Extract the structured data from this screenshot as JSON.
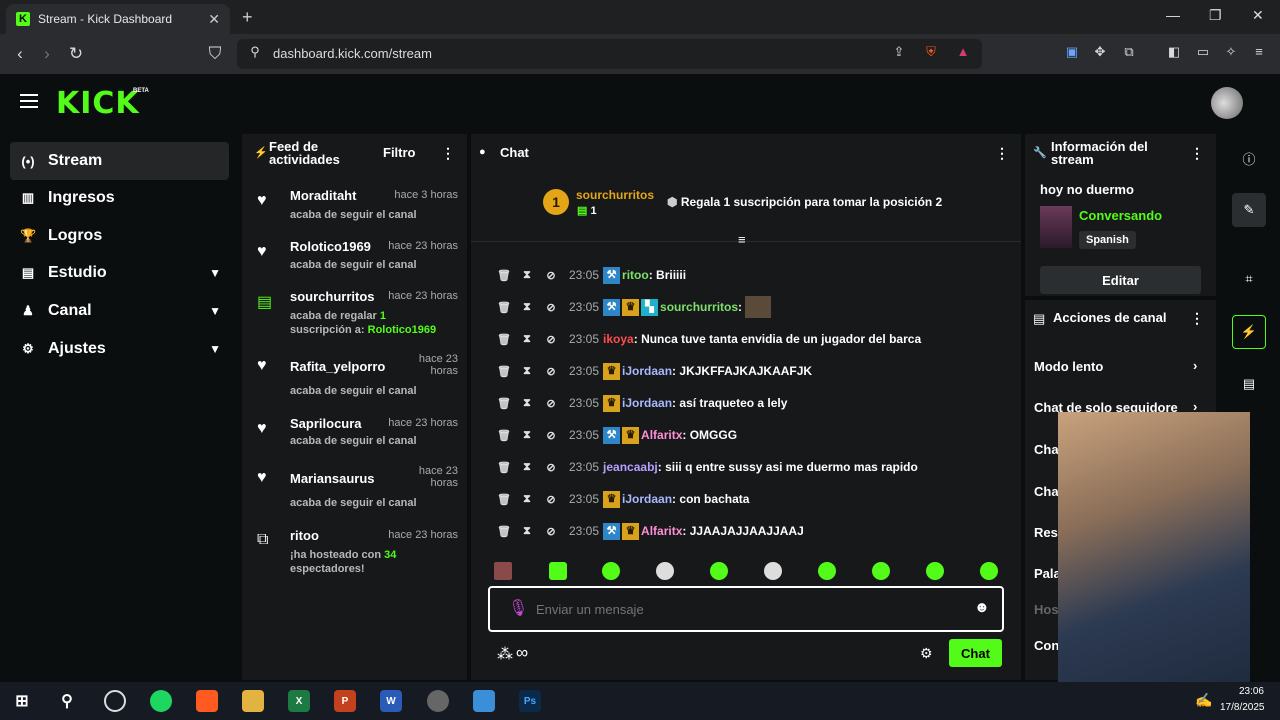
{
  "browser": {
    "tab_title": "Stream - Kick Dashboard",
    "tab_favicon": "K",
    "url": "dashboard.kick.com/stream"
  },
  "header": {
    "logo": "KICK",
    "beta": "BETA"
  },
  "sidebar": {
    "items": [
      {
        "label": "Stream",
        "icon": "(•)"
      },
      {
        "label": "Ingresos",
        "icon": "▥"
      },
      {
        "label": "Logros",
        "icon": "🏆"
      },
      {
        "label": "Estudio",
        "icon": "▤"
      },
      {
        "label": "Canal",
        "icon": "♟"
      },
      {
        "label": "Ajustes",
        "icon": "⚙"
      }
    ]
  },
  "feed": {
    "title": "Feed de actividades",
    "filter_label": "Filtro",
    "items": [
      {
        "name": "Moraditaht",
        "time": "hace 3 horas",
        "desc": "acaba de seguir el canal"
      },
      {
        "name": "Rolotico1969",
        "time": "hace 23 horas",
        "desc": "acaba de seguir el canal"
      },
      {
        "name": "sourchurritos",
        "time": "hace 23 horas",
        "desc_a": "acaba de regalar ",
        "desc_count": "1",
        "desc_b": "suscripción a: ",
        "desc_target": "Rolotico1969"
      },
      {
        "name": "Rafita_yelporro",
        "time": "hace 23 horas",
        "desc": "acaba de seguir el canal"
      },
      {
        "name": "Saprilocura",
        "time": "hace 23 horas",
        "desc": "acaba de seguir el canal"
      },
      {
        "name": "Mariansaurus",
        "time": "hace 23 horas",
        "desc": "acaba de seguir el canal"
      },
      {
        "name": "ritoo",
        "time": "hace 23 horas",
        "desc_a": "¡ha hosteado con ",
        "desc_count": "34",
        "desc_b": "espectadores!"
      }
    ]
  },
  "chat": {
    "title": "Chat",
    "leader": {
      "rank": "1",
      "name": "sourchurritos",
      "count": "1",
      "cta": "Regala 1 suscripción para tomar la posición 2"
    },
    "messages": [
      {
        "time": "23:05",
        "user": "ritoo",
        "text": "Briiiii",
        "color": "#7de06a"
      },
      {
        "time": "23:05",
        "user": "sourchurritos",
        "text": "",
        "color": "#7de06a"
      },
      {
        "time": "23:05",
        "user": "ikoya",
        "text": "Nunca tuve tanta envidia de un jugador del barca",
        "color": "#ff4d4d"
      },
      {
        "time": "23:05",
        "user": "iJordaan",
        "text": "JKJKFFAJKAJKAAFJK",
        "color": "#a9b8ff"
      },
      {
        "time": "23:05",
        "user": "iJordaan",
        "text": "así traqueteo a lely",
        "color": "#a9b8ff"
      },
      {
        "time": "23:05",
        "user": "Alfaritx",
        "text": "OMGGG",
        "color": "#ff8fd8"
      },
      {
        "time": "23:05",
        "user": "jeancaabj",
        "text": "siii q entre sussy asi me duermo mas rapido",
        "color": "#b7a1ff"
      },
      {
        "time": "23:05",
        "user": "iJordaan",
        "text": "con bachata",
        "color": "#a9b8ff"
      },
      {
        "time": "23:05",
        "user": "Alfaritx",
        "text": "JJAAJAJJAAJJAAJ",
        "color": "#ff8fd8"
      }
    ],
    "input_placeholder": "Enviar un mensaje",
    "send_label": "Chat"
  },
  "stream_info": {
    "title": "Información del stream",
    "stream_title": "hoy no duermo",
    "category": "Conversando",
    "language": "Spanish",
    "edit_label": "Editar"
  },
  "channel_actions": {
    "title": "Acciones de canal",
    "items": [
      "Modo lento",
      "Chat de solo seguidore",
      "Cha",
      "Cha",
      "Rest",
      "Pala",
      "Hos",
      "Con"
    ]
  },
  "taskbar": {
    "time": "23:06",
    "date": "17/8/2025"
  }
}
